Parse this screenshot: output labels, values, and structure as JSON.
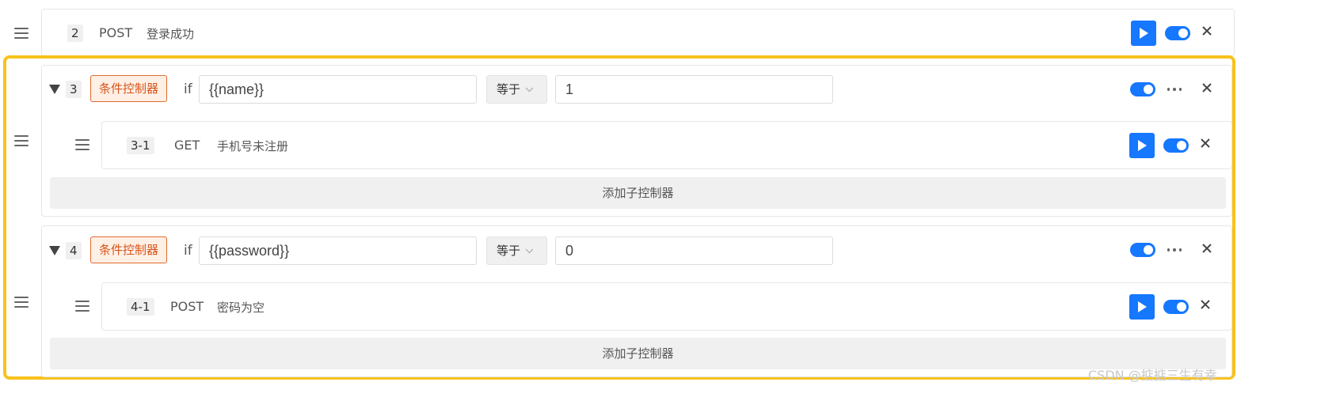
{
  "step2": {
    "num": "2",
    "method": "POST",
    "desc": "登录成功"
  },
  "ctrl3": {
    "num": "3",
    "tag": "条件控制器",
    "if_label": "if",
    "variable": "{{name}}",
    "operator": "等于",
    "value": "1",
    "child": {
      "num": "3-1",
      "method": "GET",
      "desc": "手机号未注册"
    },
    "add_label": "添加子控制器"
  },
  "ctrl4": {
    "num": "4",
    "tag": "条件控制器",
    "if_label": "if",
    "variable": "{{password}}",
    "operator": "等于",
    "value": "0",
    "child": {
      "num": "4-1",
      "method": "POST",
      "desc": "密码为空"
    },
    "add_label": "添加子控制器"
  },
  "watermark": "CSDN @掂掂三生有幸",
  "colors": {
    "accent": "#1677ff",
    "highlight": "#f8c21c",
    "tag_border": "#e06a2c",
    "tag_bg": "#fff0e6"
  },
  "icons": {
    "handle": "drag-handle-icon",
    "play": "play-icon",
    "toggle": "toggle-switch",
    "close": "close-icon",
    "more": "more-icon",
    "caret": "caret-down-icon",
    "chevron": "chevron-down-icon"
  }
}
